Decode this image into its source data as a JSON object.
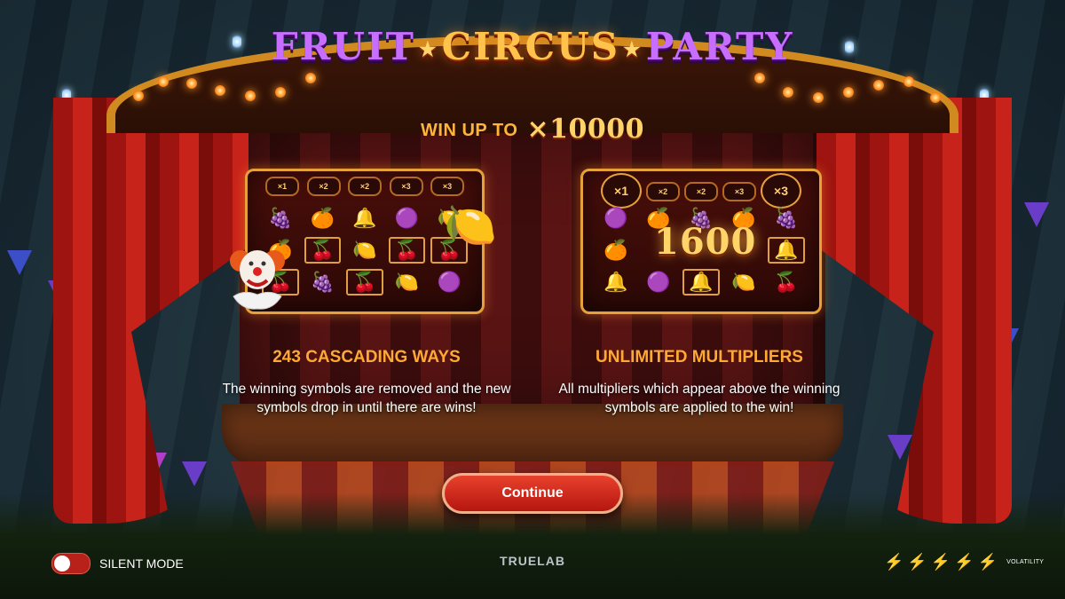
{
  "game": {
    "title_words": [
      "FRUIT",
      "CIRCUS",
      "PARTY"
    ],
    "star": "★",
    "win_up_label": "WIN UP TO",
    "win_up_value": "×10000"
  },
  "features": [
    {
      "title": "243 CASCADING WAYS",
      "text": "The winning symbols are removed and the new symbols drop in until there are wins!",
      "multipliers": [
        "×1",
        "×2",
        "×2",
        "×3",
        "×3"
      ]
    },
    {
      "title": "UNLIMITED MULTIPLIERS",
      "text": "All multipliers which appear above the winning symbols are applied to the win!",
      "multipliers": [
        "×1",
        "×2",
        "×2",
        "×3",
        "×3"
      ],
      "win_amount": "1600"
    }
  ],
  "panel1_symbols": [
    "🍇",
    "🍊",
    "🔔",
    "🟣",
    "🍋",
    "🍊",
    "🍒",
    "🍋",
    "🍒",
    "🍒",
    "🍒",
    "🍇",
    "🍒",
    "🍋",
    "🟣"
  ],
  "panel1_highlight": [
    6,
    8,
    9,
    10,
    12
  ],
  "panel2_symbols": [
    "🟣",
    "🍊",
    "🍇",
    "🍊",
    "🍇",
    "🍊",
    "",
    "",
    "",
    "🔔",
    "🔔",
    "🟣",
    "🔔",
    "🍋",
    "🍒"
  ],
  "panel2_highlight": [
    9,
    12
  ],
  "continue_label": "Continue",
  "silent_mode_label": "SILENT MODE",
  "silent_mode_on": false,
  "provider_logo": "TRUELAB",
  "volatility_label": "VOLATILITY",
  "volatility_level": 5,
  "colors": {
    "accent_orange": "#ffa935",
    "button_red": "#d22a1e",
    "gold": "#ffd56a"
  }
}
